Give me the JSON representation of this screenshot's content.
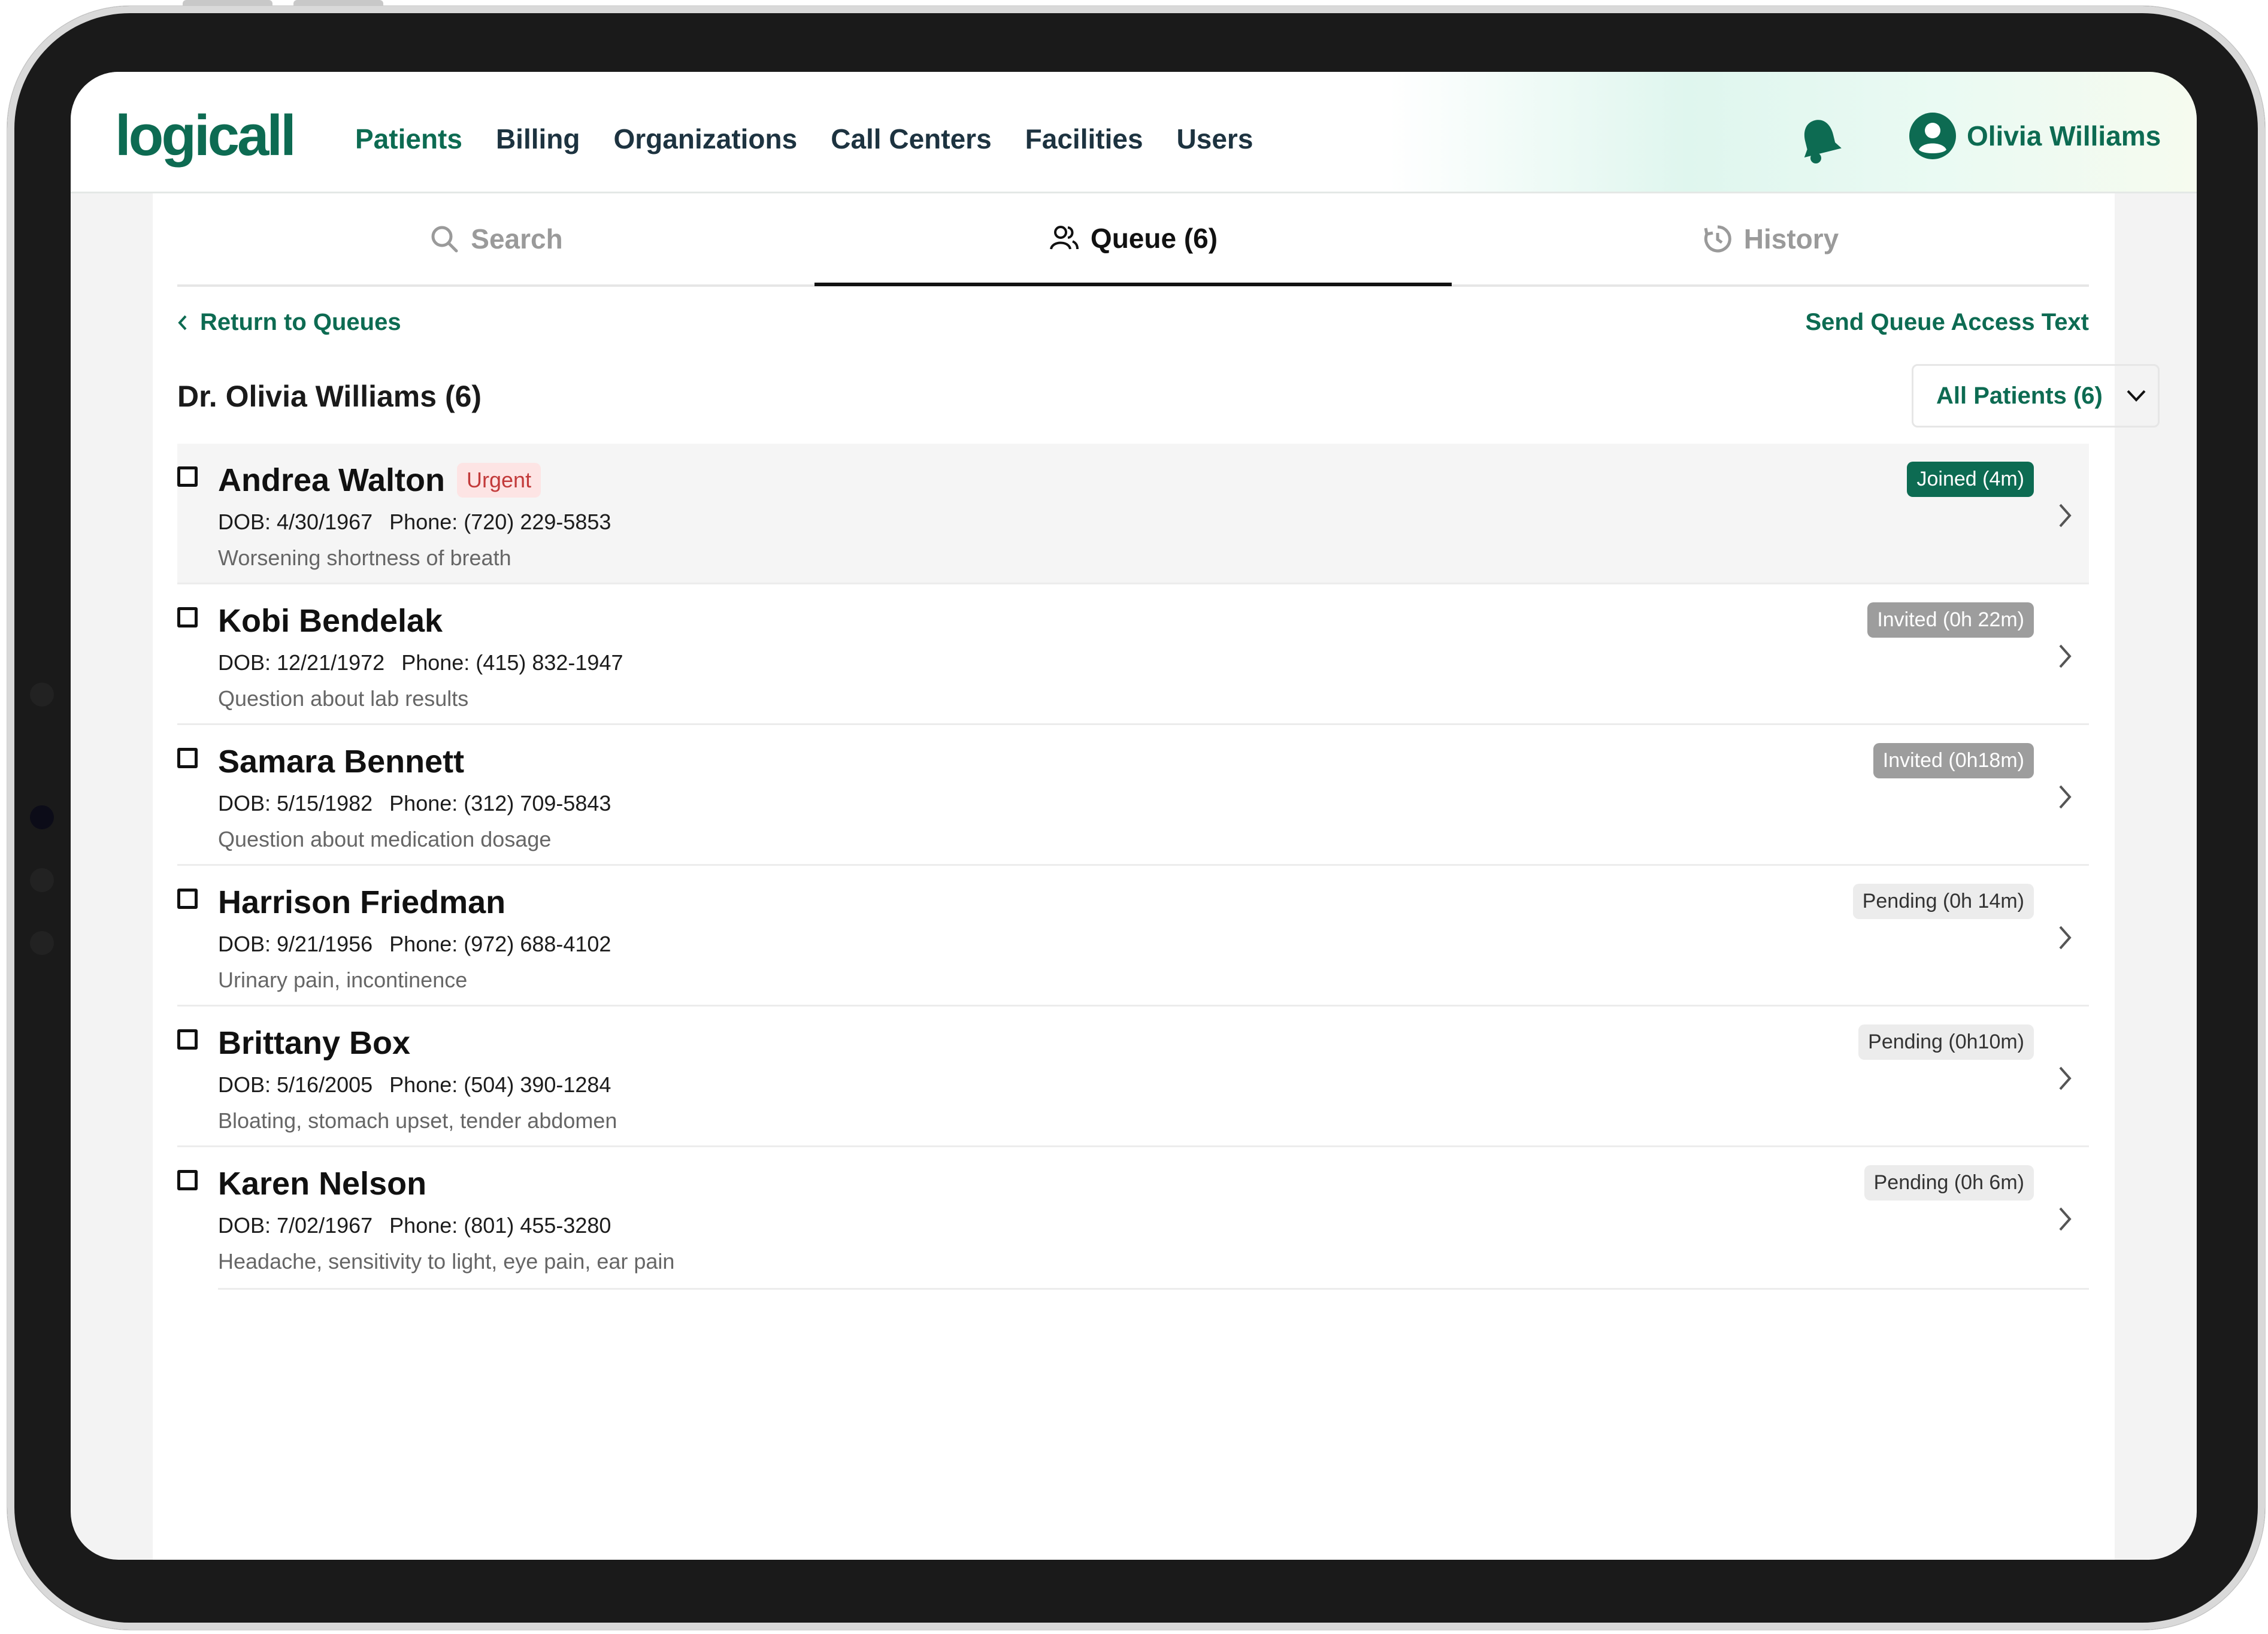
{
  "app": {
    "logo": "logicall",
    "nav": [
      "Patients",
      "Billing",
      "Organizations",
      "Call Centers",
      "Facilities",
      "Users"
    ],
    "active_nav": "Patients",
    "user_name": "Olivia Williams"
  },
  "tabs": {
    "search": "Search",
    "queue": "Queue (6)",
    "history": "History",
    "active": "Queue"
  },
  "actions": {
    "return_label": "Return to Queues",
    "send_text_label": "Send Queue Access Text"
  },
  "queue": {
    "title": "Dr. Olivia Williams (6)",
    "filter_selected": "All Patients (6)"
  },
  "patients": [
    {
      "name": "Andrea Walton",
      "tag": "Urgent",
      "dob": "DOB: 4/30/1967",
      "phone": "Phone: (720) 229-5853",
      "reason": "Worsening shortness of breath",
      "status": "Joined (4m)",
      "status_type": "joined"
    },
    {
      "name": "Kobi Bendelak",
      "tag": "",
      "dob": "DOB: 12/21/1972",
      "phone": "Phone: (415) 832-1947",
      "reason": "Question about lab results",
      "status": "Invited (0h 22m)",
      "status_type": "invited"
    },
    {
      "name": "Samara Bennett",
      "tag": "",
      "dob": "DOB: 5/15/1982",
      "phone": "Phone: (312) 709-5843",
      "reason": "Question about medication dosage",
      "status": "Invited (0h18m)",
      "status_type": "invited"
    },
    {
      "name": "Harrison Friedman",
      "tag": "",
      "dob": "DOB: 9/21/1956",
      "phone": "Phone: (972) 688-4102",
      "reason": "Urinary pain, incontinence",
      "status": "Pending (0h 14m)",
      "status_type": "pending"
    },
    {
      "name": "Brittany Box",
      "tag": "",
      "dob": "DOB: 5/16/2005",
      "phone": "Phone: (504) 390-1284",
      "reason": "Bloating, stomach upset, tender abdomen",
      "status": "Pending (0h10m)",
      "status_type": "pending"
    },
    {
      "name": "Karen Nelson",
      "tag": "",
      "dob": "DOB: 7/02/1967",
      "phone": "Phone: (801) 455-3280",
      "reason": "Headache, sensitivity to light, eye pain, ear pain",
      "status": "Pending (0h 6m)",
      "status_type": "pending"
    }
  ],
  "colors": {
    "brand": "#0d6b52",
    "urgent": "#c23a3a",
    "invited_badge": "#9d9d9d",
    "pending_badge": "#ececec"
  },
  "icons": [
    "bell-icon",
    "user-avatar-icon",
    "search-icon",
    "people-icon",
    "history-icon",
    "chevron-left-icon",
    "chevron-down-icon",
    "chevron-right-icon"
  ]
}
